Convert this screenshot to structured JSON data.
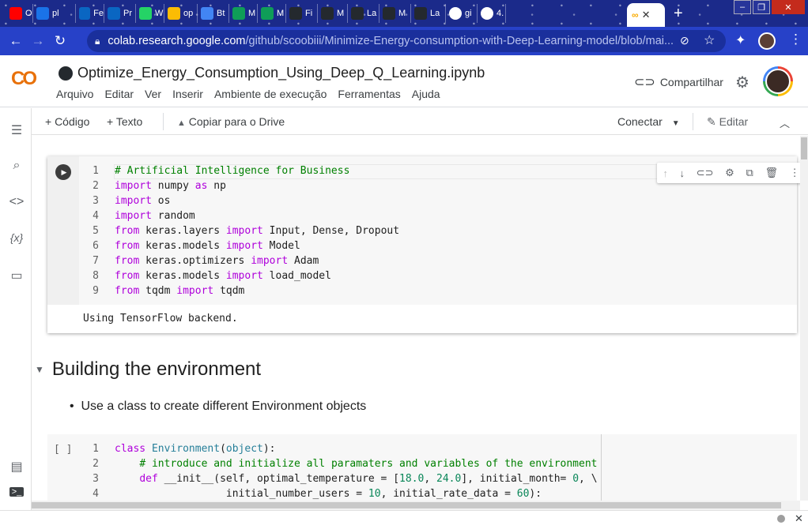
{
  "browser": {
    "tabs": [
      {
        "label": "O",
        "icon": "youtube-icon",
        "color": "#ff0000"
      },
      {
        "label": "pl",
        "icon": "dots-icon",
        "color": "#1a73e8"
      },
      {
        "label": "Fe",
        "icon": "linkedin-icon",
        "color": "#0a66c2"
      },
      {
        "label": "Pr",
        "icon": "linkedin-icon",
        "color": "#0a66c2"
      },
      {
        "label": "W",
        "icon": "whatsapp-icon",
        "color": "#25d366"
      },
      {
        "label": "op",
        "icon": "drive-icon",
        "color": "#fbbc04"
      },
      {
        "label": "Bt",
        "icon": "cloud-icon",
        "color": "#4285f4"
      },
      {
        "label": "M",
        "icon": "sheets-icon",
        "color": "#0f9d58"
      },
      {
        "label": "M",
        "icon": "sheets-icon",
        "color": "#0f9d58"
      },
      {
        "label": "Fi",
        "icon": "github-icon",
        "color": "#24292e"
      },
      {
        "label": "M",
        "icon": "github-icon",
        "color": "#24292e"
      },
      {
        "label": "La",
        "icon": "github-icon",
        "color": "#24292e"
      },
      {
        "label": "M",
        "icon": "github-icon",
        "color": "#24292e"
      },
      {
        "label": "La",
        "icon": "github-icon",
        "color": "#24292e"
      },
      {
        "label": "gi",
        "icon": "globe-icon",
        "color": "#ffffff"
      },
      {
        "label": "4.",
        "icon": "globe-icon",
        "color": "#ffffff"
      }
    ],
    "new_tab_symbol": "+",
    "url_host": "colab.research.google.com",
    "url_path": "/github/scoobiii/Minimize-Energy-consumption-with-Deep-Learning-model/blob/mai..."
  },
  "header": {
    "logo": "CO",
    "title": "Optimize_Energy_Consumption_Using_Deep_Q_Learning.ipynb",
    "menu": [
      "Arquivo",
      "Editar",
      "Ver",
      "Inserir",
      "Ambiente de execução",
      "Ferramentas",
      "Ajuda"
    ],
    "share_label": "Compartilhar"
  },
  "notebook_toolbar": {
    "add_code": "+ Código",
    "add_text": "+ Texto",
    "copy_drive": "Copiar para o Drive",
    "connect": "Conectar",
    "edit": "Editar"
  },
  "cell1": {
    "lines": [
      {
        "n": "1",
        "parts": [
          {
            "t": "# Artificial Intelligence for Business",
            "c": "cm"
          }
        ]
      },
      {
        "n": "2",
        "parts": [
          {
            "t": "import",
            "c": "kw"
          },
          {
            "t": " numpy ",
            "c": ""
          },
          {
            "t": "as",
            "c": "kw"
          },
          {
            "t": " np",
            "c": ""
          }
        ]
      },
      {
        "n": "3",
        "parts": [
          {
            "t": "import",
            "c": "kw"
          },
          {
            "t": " os",
            "c": ""
          }
        ]
      },
      {
        "n": "4",
        "parts": [
          {
            "t": "import",
            "c": "kw"
          },
          {
            "t": " random",
            "c": ""
          }
        ]
      },
      {
        "n": "5",
        "parts": [
          {
            "t": "from",
            "c": "kw"
          },
          {
            "t": " keras.layers ",
            "c": ""
          },
          {
            "t": "import",
            "c": "kw"
          },
          {
            "t": " Input, Dense, Dropout",
            "c": ""
          }
        ]
      },
      {
        "n": "6",
        "parts": [
          {
            "t": "from",
            "c": "kw"
          },
          {
            "t": " keras.models ",
            "c": ""
          },
          {
            "t": "import",
            "c": "kw"
          },
          {
            "t": " Model",
            "c": ""
          }
        ]
      },
      {
        "n": "7",
        "parts": [
          {
            "t": "from",
            "c": "kw"
          },
          {
            "t": " keras.optimizers ",
            "c": ""
          },
          {
            "t": "import",
            "c": "kw"
          },
          {
            "t": " Adam",
            "c": ""
          }
        ]
      },
      {
        "n": "8",
        "parts": [
          {
            "t": "from",
            "c": "kw"
          },
          {
            "t": " keras.models ",
            "c": ""
          },
          {
            "t": "import",
            "c": "kw"
          },
          {
            "t": " load_model",
            "c": ""
          }
        ]
      },
      {
        "n": "9",
        "parts": [
          {
            "t": "from",
            "c": "kw"
          },
          {
            "t": " tqdm ",
            "c": ""
          },
          {
            "t": "import",
            "c": "kw"
          },
          {
            "t": " tqdm",
            "c": ""
          }
        ]
      }
    ],
    "output": "Using TensorFlow backend."
  },
  "section": {
    "heading": "Building the environment",
    "bullet": "Use a class to create different Environment objects"
  },
  "cell2": {
    "bracket": "[ ]",
    "lines": [
      {
        "n": "1",
        "parts": [
          {
            "t": "class",
            "c": "kw"
          },
          {
            "t": " ",
            "c": ""
          },
          {
            "t": "Environment",
            "c": "cls"
          },
          {
            "t": "(",
            "c": ""
          },
          {
            "t": "object",
            "c": "cls"
          },
          {
            "t": "):",
            "c": ""
          }
        ]
      },
      {
        "n": "2",
        "parts": [
          {
            "t": "    ",
            "c": ""
          },
          {
            "t": "# introduce and initialize all paramaters and variables of the environment",
            "c": "cm"
          }
        ]
      },
      {
        "n": "3",
        "parts": [
          {
            "t": "    ",
            "c": ""
          },
          {
            "t": "def",
            "c": "kw"
          },
          {
            "t": " __init__(self, optimal_temperature = [",
            "c": ""
          },
          {
            "t": "18.0",
            "c": "nm"
          },
          {
            "t": ", ",
            "c": ""
          },
          {
            "t": "24.0",
            "c": "nm"
          },
          {
            "t": "], initial_month= ",
            "c": ""
          },
          {
            "t": "0",
            "c": "nm"
          },
          {
            "t": ", \\",
            "c": ""
          }
        ]
      },
      {
        "n": "4",
        "parts": [
          {
            "t": "                  initial_number_users = ",
            "c": ""
          },
          {
            "t": "10",
            "c": "nm"
          },
          {
            "t": ", initial_rate_data = ",
            "c": ""
          },
          {
            "t": "60",
            "c": "nm"
          },
          {
            "t": "):",
            "c": ""
          }
        ]
      }
    ]
  }
}
